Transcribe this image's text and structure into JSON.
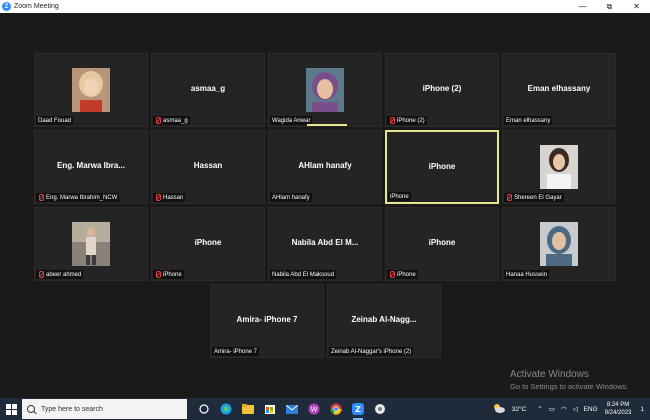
{
  "window": {
    "title": "Zoom Meeting",
    "controls": {
      "minimize": "—",
      "maximize": "⧉",
      "close": "✕"
    }
  },
  "tiles": [
    {
      "display": "",
      "label": "Daad Fouad",
      "muted": false,
      "avatar": "woman-blonde-photo"
    },
    {
      "display": "asmaa_g",
      "label": "asmaa_g",
      "muted": true
    },
    {
      "display": "",
      "label": "Wagida Anwar",
      "muted": false,
      "avatar": "woman-headscarf-photo",
      "speaking": true
    },
    {
      "display": "iPhone (2)",
      "label": "iPhone (2)",
      "muted": true
    },
    {
      "display": "Eman elhassany",
      "label": "Eman elhassany",
      "muted": false
    },
    {
      "display": "Eng. Marwa Ibra...",
      "label": "Eng. Marwa Ibrahim_NCW",
      "muted": true
    },
    {
      "display": "Hassan",
      "label": "Hassan",
      "muted": true
    },
    {
      "display": "AHlam hanafy",
      "label": "AHlam hanafy",
      "muted": false
    },
    {
      "display": "iPhone",
      "label": "iPhone",
      "muted": false,
      "active": true
    },
    {
      "display": "",
      "label": "Shereen El Gayar",
      "muted": true,
      "avatar": "woman-white-shirt-photo"
    },
    {
      "display": "",
      "label": "abeer ahmed",
      "muted": true,
      "avatar": "woman-standing-photo"
    },
    {
      "display": "iPhone",
      "label": "iPhone",
      "muted": true
    },
    {
      "display": "Nabila Abd El M...",
      "label": "Nabila Abd El Maksoud",
      "muted": false
    },
    {
      "display": "iPhone",
      "label": "iPhone",
      "muted": true
    },
    {
      "display": "",
      "label": "Hanaa Hussein",
      "muted": false,
      "avatar": "woman-headscarf-photo"
    },
    {
      "display": "Amira- iPhone 7",
      "label": "Amira- iPhone 7",
      "muted": false
    },
    {
      "display": "Zeinab  Al-Nagg...",
      "label": "Zeinab Al-Naggar's iPhone (2)",
      "muted": false
    }
  ],
  "watermark": {
    "line1": "Activate Windows",
    "line2": "Go to Settings to activate Windows."
  },
  "taskbar": {
    "search_placeholder": "Type here to search",
    "apps": [
      "task-view-icon",
      "edge-icon",
      "file-explorer-icon",
      "store-icon",
      "mail-icon",
      "app-icon",
      "chrome-icon",
      "zoom-icon",
      "photos-icon"
    ],
    "temperature": "32°C",
    "language": "ENG",
    "time": "8:24 PM",
    "date": "9/24/2023",
    "notifications": "1"
  },
  "colors": {
    "background": "#1a1a1a",
    "tile": "#242424",
    "active_border": "#e8e48a",
    "mute_red": "#e03e3e",
    "zoom_blue": "#2d8cff"
  }
}
